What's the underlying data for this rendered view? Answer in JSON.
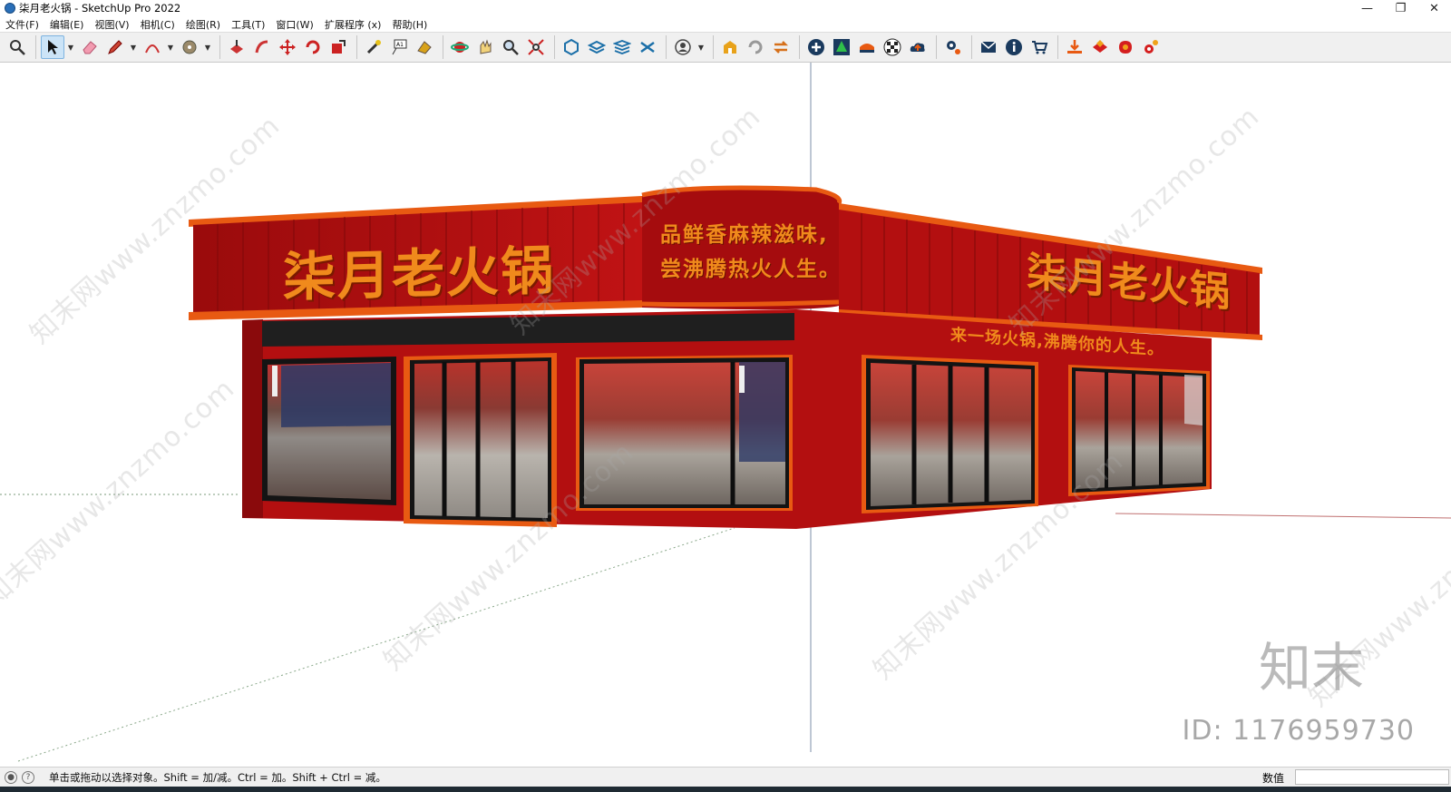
{
  "window": {
    "title": "柒月老火锅 - SketchUp Pro 2022",
    "controls": [
      "—",
      "❐",
      "✕"
    ]
  },
  "menu": [
    "文件(F)",
    "编辑(E)",
    "视图(V)",
    "相机(C)",
    "绘图(R)",
    "工具(T)",
    "窗口(W)",
    "扩展程序 (x)",
    "帮助(H)"
  ],
  "toolbar": {
    "icons": [
      "zoom-icon",
      "select-arrow-icon",
      "eraser-icon",
      "pencil-line-icon",
      "arc-icon",
      "paint-bucket-icon",
      "push-pull-icon",
      "follow-me-icon",
      "move-icon",
      "rotate-icon",
      "scale-icon",
      "tape-measure-icon",
      "text-label-icon",
      "paint-icon",
      "orbit-icon",
      "pan-icon",
      "zoom-tool-icon",
      "zoom-extents-icon",
      "component-icon",
      "layers-icon",
      "styles-icon",
      "scenes-icon",
      "user-icon",
      "warehouse-icon",
      "refresh-icon",
      "swap-icon",
      "add-icon",
      "tree-icon",
      "sandbox-icon",
      "checker-icon",
      "cloud-icon",
      "settings-icon",
      "mail-icon",
      "info-icon",
      "cart-icon",
      "download-icon",
      "extension-icon",
      "ruby-icon",
      "gear-extension-icon"
    ]
  },
  "scene": {
    "signs": {
      "main_left": "柒月老火锅",
      "main_right": "柒月老火锅",
      "curve_line1": "品鲜香麻辣滋味,",
      "curve_line2": "尝沸腾热火人生。",
      "slogan": "来一场火锅,沸腾你的人生。"
    },
    "colors": {
      "facade_red": "#b30f10",
      "dark_red": "#8a0a0c",
      "text_orange": "#f08a1c",
      "trim_orange": "#e85a12",
      "glass_dark": "#1a1a1a"
    }
  },
  "watermarks": {
    "text": "知末网www.znzmo.com",
    "logo": "知末",
    "id": "ID: 1176959730"
  },
  "status": {
    "hint": "单击或拖动以选择对象。Shift = 加/减。Ctrl = 加。Shift + Ctrl = 减。",
    "measure_label": "数值",
    "measure_value": ""
  }
}
